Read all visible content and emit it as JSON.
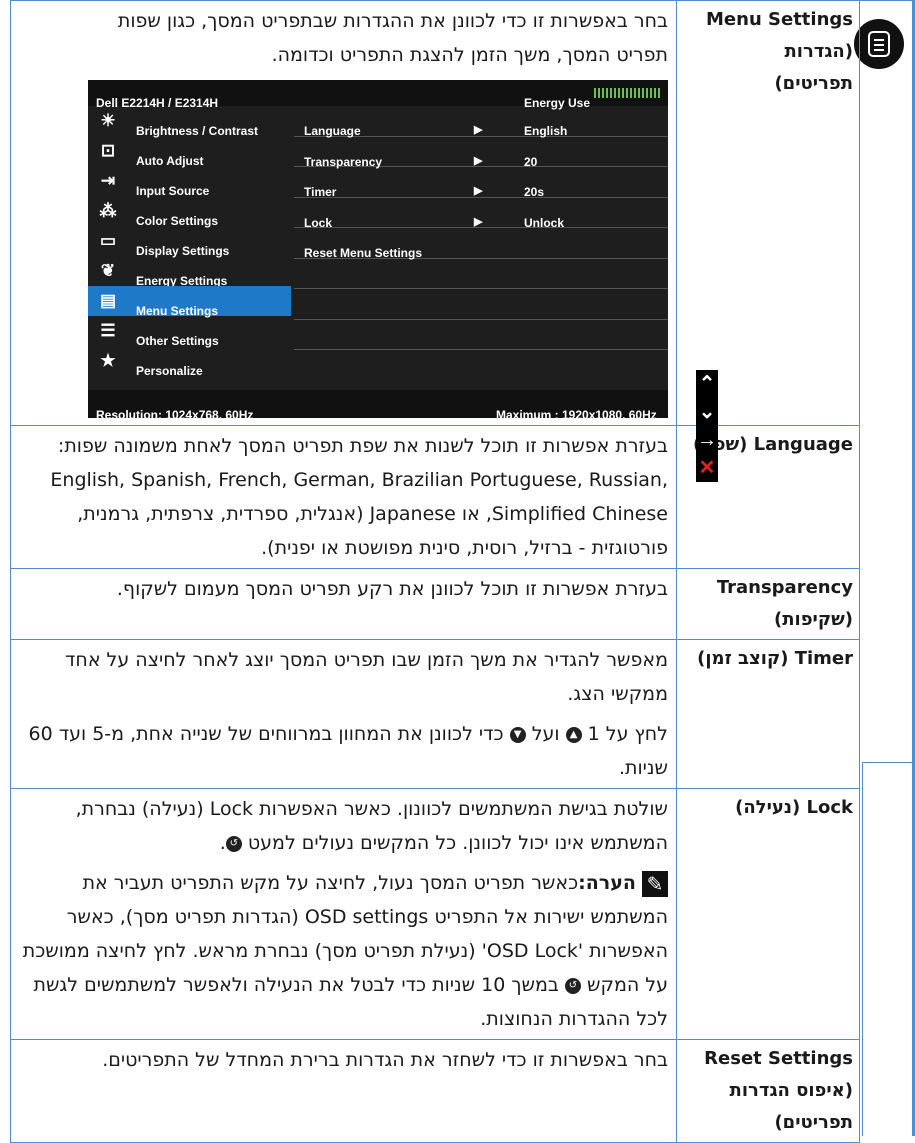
{
  "menu_settings": {
    "label_line1": "Menu Settings",
    "label_line2": "(הגדרות",
    "label_line3": "תפריטים)",
    "desc_line1": "בחר באפשרות זו כדי לכוונן את ההגדרות שבתפריט המסך, כגון שפות",
    "desc_line2": "תפריט המסך, משך הזמן להצגת התפריט וכדומה."
  },
  "osd": {
    "model": "Dell E2214H / E2314H",
    "energy_label": "Energy Use",
    "menu_items": [
      {
        "label": "Brightness / Contrast",
        "icon": "sun-icon"
      },
      {
        "label": "Auto Adjust",
        "icon": "auto-adjust-icon"
      },
      {
        "label": "Input Source",
        "icon": "input-source-icon"
      },
      {
        "label": "Color Settings",
        "icon": "color-dots-icon"
      },
      {
        "label": "Display Settings",
        "icon": "display-rect-icon"
      },
      {
        "label": "Energy Settings",
        "icon": "leaf-icon"
      },
      {
        "label": "Menu Settings",
        "icon": "menu-doc-icon",
        "selected": true
      },
      {
        "label": "Other Settings",
        "icon": "sliders-icon"
      },
      {
        "label": "Personalize",
        "icon": "star-icon"
      }
    ],
    "rows": [
      {
        "key": "Language",
        "value": "English"
      },
      {
        "key": "Transparency",
        "value": "20"
      },
      {
        "key": "Timer",
        "value": "20s"
      },
      {
        "key": "Lock",
        "value": "Unlock"
      },
      {
        "key": "Reset Menu Settings",
        "value": ""
      }
    ],
    "resolution": "Resolution: 1024x768,  60Hz",
    "maximum": "Maximum : 1920x1080,  60Hz"
  },
  "language": {
    "label": "Language (שפה)",
    "desc": "בעזרת אפשרות זו תוכל לשנות את שפת תפריט המסך לאחת משמונה שפות: English, Spanish, French, German, Brazilian Portuguese, Russian, Simplified Chinese, או Japanese (אנגלית, ספרדית, צרפתית, גרמנית, פורטוגזית - ברזיל, רוסית, סינית מפושטת או יפנית)."
  },
  "transparency": {
    "label_line1": "Transparency",
    "label_line2": "(שקיפות)",
    "desc": "בעזרת אפשרות זו תוכל לכוונן את רקע תפריט המסך מעמום לשקוף."
  },
  "timer": {
    "label": "Timer (קוצב זמן)",
    "desc1": "מאפשר להגדיר את משך הזמן שבו תפריט המסך יוצג לאחר לחיצה על אחד ממקשי הצג.",
    "desc2_a": "לחץ על 1",
    "desc2_b": "ועל",
    "desc2_c": "כדי לכוונן את המחוון במרווחים של שנייה אחת, מ-5 ועד 60 שניות."
  },
  "lock": {
    "label": "Lock (נעילה)",
    "desc1": "שולטת בגישת המשתמשים לכוונון. כאשר האפשרות Lock (נעילה) נבחרת, המשתמש אינו יכול לכוונן. כל המקשים נעולים למעט",
    "note_title": "הערה:",
    "note_body_a": "כאשר תפריט המסך נעול, לחיצה על מקש התפריט תעביר את המשתמש ישירות אל התפריט OSD settings (הגדרות תפריט מסך), כאשר האפשרות 'OSD Lock' (נעילת תפריט מסך) נבחרת מראש. לחץ לחיצה ממושכת על המקש",
    "note_body_b": "במשך 10 שניות כדי לבטל את הנעילה ולאפשר למשתמשים לגשת לכל ההגדרות הנחוצות."
  },
  "reset": {
    "label_line1": "Reset Settings",
    "label_line2": "(איפוס הגדרות",
    "label_line3": "תפריטים)",
    "desc": "בחר באפשרות זו כדי לשחזר את הגדרות ברירת המחדל של התפריטים."
  },
  "colors": {
    "accent": "#4d8fd1",
    "osd_selected": "#1f79c9",
    "close_red": "#e52020"
  }
}
